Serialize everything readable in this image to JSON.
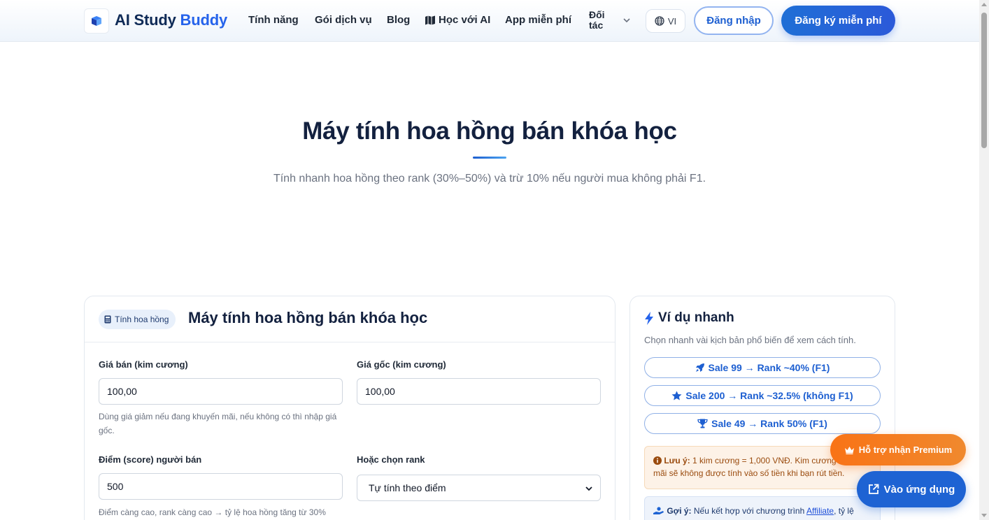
{
  "header": {
    "brand_main": "AI Study",
    "brand_accent": "Buddy",
    "nav": [
      "Tính năng",
      "Gói dịch vụ",
      "Blog",
      "Học với AI",
      "App miễn phí"
    ],
    "partners_line1": "Đối",
    "partners_line2": "tác",
    "language": "VI",
    "login": "Đăng nhập",
    "signup": "Đăng ký miễn phí"
  },
  "hero": {
    "title": "Máy tính hoa hồng bán khóa học",
    "subtitle": "Tính nhanh hoa hồng theo rank (30%–50%) và trừ 10% nếu người mua không phải F1."
  },
  "calculator": {
    "tag": "Tính hoa hồng",
    "title": "Máy tính hoa hồng bán khóa học",
    "sale_price_label": "Giá bán (kim cương)",
    "sale_price_value": "100,00",
    "sale_price_help": "Dùng giá giảm nếu đang khuyến mãi, nếu không có thì nhập giá gốc.",
    "original_price_label": "Giá gốc (kim cương)",
    "original_price_value": "100,00",
    "score_label": "Điểm (score) người bán",
    "score_value": "500",
    "score_help": "Điểm càng cao, rank càng cao → tỷ lệ hoa hồng tăng từ 30%",
    "rank_label": "Hoặc chọn rank",
    "rank_value": "Tự tính theo điểm"
  },
  "examples": {
    "title": "Ví dụ nhanh",
    "description": "Chọn nhanh vài kịch bản phổ biến để xem cách tính.",
    "buttons": [
      "Sale 99 → Rank ~40% (F1)",
      "Sale 200 → Rank ~32.5% (không F1)",
      "Sale 49 → Rank 50% (F1)"
    ],
    "note_label": "Lưu ý:",
    "note_text": "1 kim cương = 1,000 VNĐ. Kim cương khuyến mãi sẽ không được tính vào số tiền khi bạn rút tiền.",
    "tip_label": "Gợi ý:",
    "tip_text": "Nếu kết hợp với chương trình",
    "tip_link": "Affiliate",
    "tip_tail": ", tỷ lệ"
  },
  "floating": {
    "premium": "Hỗ trợ nhận Premium",
    "open_app": "Vào ứng dụng"
  },
  "colors": {
    "primary": "#2563eb",
    "navy": "#13213f",
    "orange": "#f97316"
  }
}
